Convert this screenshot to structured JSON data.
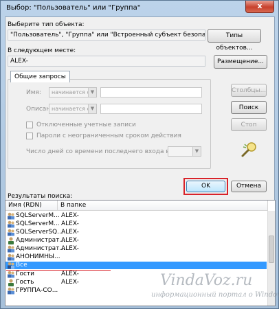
{
  "window": {
    "title": "Выбор: \"Пользователь\" или \"Группа\"",
    "close": "x"
  },
  "object_type": {
    "label": "Выберите тип объекта:",
    "value": "\"Пользователь\", \"Группа\" или \"Встроенный субъект безопасности\"",
    "button": "Типы объектов..."
  },
  "location": {
    "label": "В следующем месте:",
    "value": "ALEX-",
    "button": "Размещение..."
  },
  "queries": {
    "tab": "Общие запросы",
    "name_label": "Имя:",
    "name_combo": "начинается с",
    "desc_label": "Описание:",
    "desc_combo": "начинается с",
    "disabled_accounts": "Отключенные учетные записи",
    "no_expire_passwords": "Пароли с неограниченным сроком действия",
    "days_label": "Число дней со времени последнего входа в систему:"
  },
  "side_buttons": {
    "columns": "Столбцы...",
    "search": "Поиск",
    "stop": "Стоп"
  },
  "actions": {
    "ok": "OK",
    "cancel": "Отмена"
  },
  "results": {
    "label": "Результаты поиска:",
    "col_name": "Имя (RDN)",
    "col_folder": "В папке",
    "rows": [
      {
        "name": "SQLServerM...",
        "folder": "ALEX-"
      },
      {
        "name": "SQLServerM...",
        "folder": "ALEX-"
      },
      {
        "name": "SQLServerSQ...",
        "folder": "ALEX-"
      },
      {
        "name": "Администрат...",
        "folder": "ALEX-"
      },
      {
        "name": "Администрат...",
        "folder": "ALEX-"
      },
      {
        "name": "АНОНИМНЫ...",
        "folder": ""
      },
      {
        "name": "Все",
        "folder": ""
      },
      {
        "name": "Гости",
        "folder": "ALEX-"
      },
      {
        "name": "Гость",
        "folder": "ALEX-"
      },
      {
        "name": "ГРУППА-СО...",
        "folder": ""
      }
    ]
  },
  "watermark": {
    "site": "VindaVoz.ru",
    "tagline": "информационный портал о Windows"
  },
  "colors": {
    "highlight": "#d8232a",
    "selection": "#3399ff"
  }
}
